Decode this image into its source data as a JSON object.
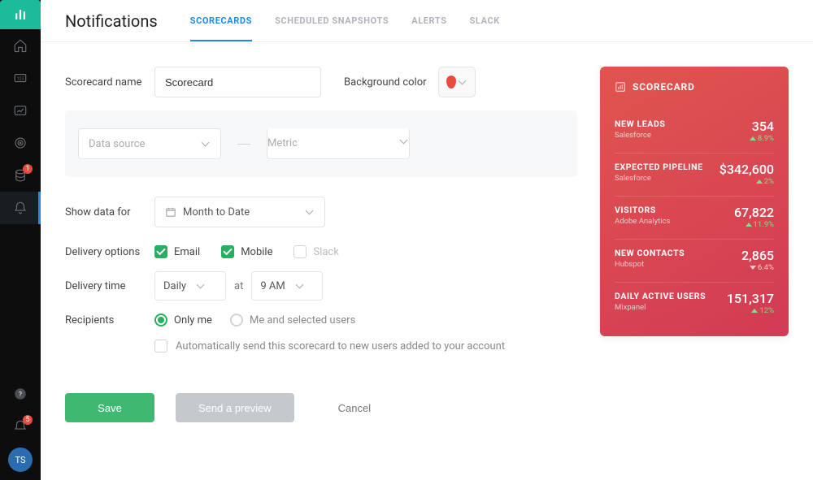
{
  "header": {
    "page_title": "Notifications",
    "tabs": [
      {
        "label": "SCORECARDS",
        "active": true
      },
      {
        "label": "SCHEDULED SNAPSHOTS",
        "active": false
      },
      {
        "label": "ALERTS",
        "active": false
      },
      {
        "label": "SLACK",
        "active": false
      }
    ]
  },
  "form": {
    "scorecard_name_label": "Scorecard name",
    "scorecard_name_value": "Scorecard",
    "background_color_label": "Background color",
    "background_color_value": "#e74c3c",
    "data_source_placeholder": "Data source",
    "metric_placeholder": "Metric",
    "show_data_for_label": "Show data for",
    "show_data_for_value": "Month to Date",
    "delivery_options_label": "Delivery options",
    "delivery_options": [
      {
        "label": "Email",
        "checked": true
      },
      {
        "label": "Mobile",
        "checked": true
      },
      {
        "label": "Slack",
        "checked": false
      }
    ],
    "delivery_time_label": "Delivery time",
    "delivery_time_frequency": "Daily",
    "delivery_time_at": "at",
    "delivery_time_hour": "9 AM",
    "recipients_label": "Recipients",
    "recipients_options": [
      {
        "label": "Only me",
        "selected": true
      },
      {
        "label": "Me and selected users",
        "selected": false
      }
    ],
    "auto_send_label": "Automatically send this scorecard to new users added to your account",
    "save_label": "Save",
    "preview_label": "Send a preview",
    "cancel_label": "Cancel"
  },
  "sidebar": {
    "avatar_initials": "TS",
    "badge_db": "1",
    "badge_alert": "5"
  },
  "card": {
    "title": "SCORECARD",
    "metrics": [
      {
        "name": "NEW LEADS",
        "source": "Salesforce",
        "value": "354",
        "delta": "8.9%",
        "dir": "up"
      },
      {
        "name": "EXPECTED PIPELINE",
        "source": "Salesforce",
        "value": "$342,600",
        "delta": "2%",
        "dir": "up"
      },
      {
        "name": "VISITORS",
        "source": "Adobe Analytics",
        "value": "67,822",
        "delta": "11.9%",
        "dir": "up"
      },
      {
        "name": "NEW CONTACTS",
        "source": "Hubspot",
        "value": "2,865",
        "delta": "6.4%",
        "dir": "down"
      },
      {
        "name": "DAILY ACTIVE USERS",
        "source": "Mixpanel",
        "value": "151,317",
        "delta": "12%",
        "dir": "up"
      }
    ]
  }
}
